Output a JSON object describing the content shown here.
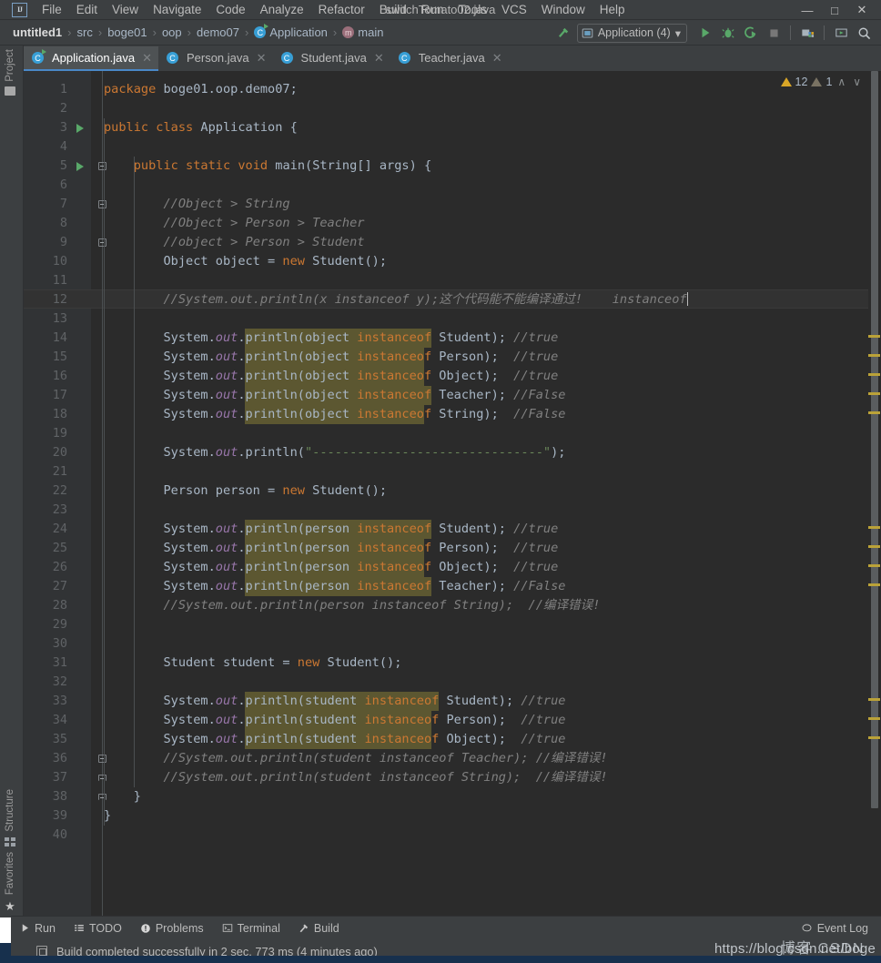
{
  "window": {
    "title": "switchTomato02.java",
    "minimize": "—",
    "maximize": "□",
    "close": "✕",
    "logo": "IJ"
  },
  "menubar": {
    "items": [
      {
        "label": "File"
      },
      {
        "label": "Edit"
      },
      {
        "label": "View"
      },
      {
        "label": "Navigate"
      },
      {
        "label": "Code"
      },
      {
        "label": "Analyze"
      },
      {
        "label": "Refactor"
      },
      {
        "label": "Build"
      },
      {
        "label": "Run"
      },
      {
        "label": "Tools"
      },
      {
        "label": "VCS"
      },
      {
        "label": "Window"
      },
      {
        "label": "Help"
      }
    ]
  },
  "breadcrumb": {
    "items": [
      "untitled1",
      "src",
      "boge01",
      "oop",
      "demo07",
      "Application",
      "main"
    ],
    "separator": "›",
    "class_icon": "C",
    "method_icon": "m"
  },
  "toolbar": {
    "run_config": "Application (4)",
    "dropdown_caret": "▾",
    "run_icon": "run-icon",
    "debug_icon": "debug-icon",
    "coverage_icon": "run-with-coverage-icon",
    "stop_icon": "stop-icon",
    "updates_icon": "update-project-icon",
    "present_icon": "presentation-icon",
    "search_icon": "search-everywhere-icon",
    "build_icon": "build-hammer-icon"
  },
  "toolstrips": {
    "project": "Project",
    "structure": "Structure",
    "favorites": "Favorites"
  },
  "tabs": [
    {
      "label": "Application.java",
      "active": true,
      "close": "✕"
    },
    {
      "label": "Person.java",
      "active": false,
      "close": "✕"
    },
    {
      "label": "Student.java",
      "active": false,
      "close": "✕"
    },
    {
      "label": "Teacher.java",
      "active": false,
      "close": "✕"
    }
  ],
  "inspections": {
    "warning_count": "12",
    "weak_count": "1",
    "prev": "∧",
    "next": "∨"
  },
  "editor": {
    "file": "Application.java",
    "current_line": 12,
    "total_lines": 40,
    "line_numbers": [
      1,
      2,
      3,
      4,
      5,
      6,
      7,
      8,
      9,
      10,
      11,
      12,
      13,
      14,
      15,
      16,
      17,
      18,
      19,
      20,
      21,
      22,
      23,
      24,
      25,
      26,
      27,
      28,
      29,
      30,
      31,
      32,
      33,
      34,
      35,
      36,
      37,
      38,
      39,
      40
    ],
    "caret_after_text": "instanceof",
    "code_lines": [
      {
        "n": 1,
        "text": "package boge01.oop.demo07;"
      },
      {
        "n": 2,
        "text": ""
      },
      {
        "n": 3,
        "text": "public class Application {"
      },
      {
        "n": 4,
        "text": ""
      },
      {
        "n": 5,
        "text": "    public static void main(String[] args) {"
      },
      {
        "n": 6,
        "text": ""
      },
      {
        "n": 7,
        "text": "        //Object > String"
      },
      {
        "n": 8,
        "text": "        //Object > Person > Teacher"
      },
      {
        "n": 9,
        "text": "        //object > Person > Student"
      },
      {
        "n": 10,
        "text": "        Object object = new Student();"
      },
      {
        "n": 11,
        "text": ""
      },
      {
        "n": 12,
        "text": "        //System.out.println(x instanceof y);这个代码能不能编译通过!    instanceof"
      },
      {
        "n": 13,
        "text": ""
      },
      {
        "n": 14,
        "text": "        System.out.println(object instanceof Student); //true"
      },
      {
        "n": 15,
        "text": "        System.out.println(object instanceof Person);  //true"
      },
      {
        "n": 16,
        "text": "        System.out.println(object instanceof Object);  //true"
      },
      {
        "n": 17,
        "text": "        System.out.println(object instanceof Teacher); //False"
      },
      {
        "n": 18,
        "text": "        System.out.println(object instanceof String);  //False"
      },
      {
        "n": 19,
        "text": ""
      },
      {
        "n": 20,
        "text": "        System.out.println(\"-------------------------------\");"
      },
      {
        "n": 21,
        "text": ""
      },
      {
        "n": 22,
        "text": "        Person person = new Student();"
      },
      {
        "n": 23,
        "text": ""
      },
      {
        "n": 24,
        "text": "        System.out.println(person instanceof Student); //true"
      },
      {
        "n": 25,
        "text": "        System.out.println(person instanceof Person);  //true"
      },
      {
        "n": 26,
        "text": "        System.out.println(person instanceof Object);  //true"
      },
      {
        "n": 27,
        "text": "        System.out.println(person instanceof Teacher); //False"
      },
      {
        "n": 28,
        "text": "        //System.out.println(person instanceof String);  //编译错误!"
      },
      {
        "n": 29,
        "text": ""
      },
      {
        "n": 30,
        "text": ""
      },
      {
        "n": 31,
        "text": "        Student student = new Student();"
      },
      {
        "n": 32,
        "text": ""
      },
      {
        "n": 33,
        "text": "        System.out.println(student instanceof Student); //true"
      },
      {
        "n": 34,
        "text": "        System.out.println(student instanceof Person);  //true"
      },
      {
        "n": 35,
        "text": "        System.out.println(student instanceof Object);  //true"
      },
      {
        "n": 36,
        "text": "        //System.out.println(student instanceof Teacher); //编译错误!"
      },
      {
        "n": 37,
        "text": "        //System.out.println(student instanceof String);  //编译错误!"
      },
      {
        "n": 38,
        "text": "    }"
      },
      {
        "n": 39,
        "text": "}"
      },
      {
        "n": 40,
        "text": ""
      }
    ],
    "run_arrow_lines": [
      3,
      5
    ],
    "fold_lines": [
      5,
      7,
      9,
      36,
      37,
      38
    ],
    "warning_marker_lines": [
      14,
      15,
      16,
      17,
      18,
      24,
      25,
      26,
      27,
      33,
      34,
      35
    ]
  },
  "bottom_tools": [
    {
      "label": "Run",
      "icon": "run-icon"
    },
    {
      "label": "TODO",
      "icon": "todo-list-icon"
    },
    {
      "label": "Problems",
      "icon": "problems-icon"
    },
    {
      "label": "Terminal",
      "icon": "terminal-icon"
    },
    {
      "label": "Build",
      "icon": "build-hammer-icon"
    }
  ],
  "event_log": {
    "label": "Event Log",
    "icon": "balloon-icon"
  },
  "statusbar": {
    "message": "Build completed successfully in 2 sec, 773 ms (4 minutes ago)",
    "icon": "toggle-toolwindow-icon"
  },
  "watermark": {
    "line1": "https://blog.csdn.net/boge",
    "line2": "博客 CSDN"
  },
  "colors": {
    "ide_chrome": "#3c3f41",
    "editor_bg": "#2b2b2b",
    "gutter_bg": "#313335",
    "current_line": "#323232",
    "tab_active": "#4e5254",
    "tab_underline": "#4a88c7",
    "keyword": "#cc7832",
    "comment": "#808080",
    "string": "#6a8759",
    "field": "#9876aa",
    "text": "#a9b7c6",
    "search_highlight": "#5c5731",
    "warning": "#d9a627",
    "run_green": "#59a869"
  }
}
